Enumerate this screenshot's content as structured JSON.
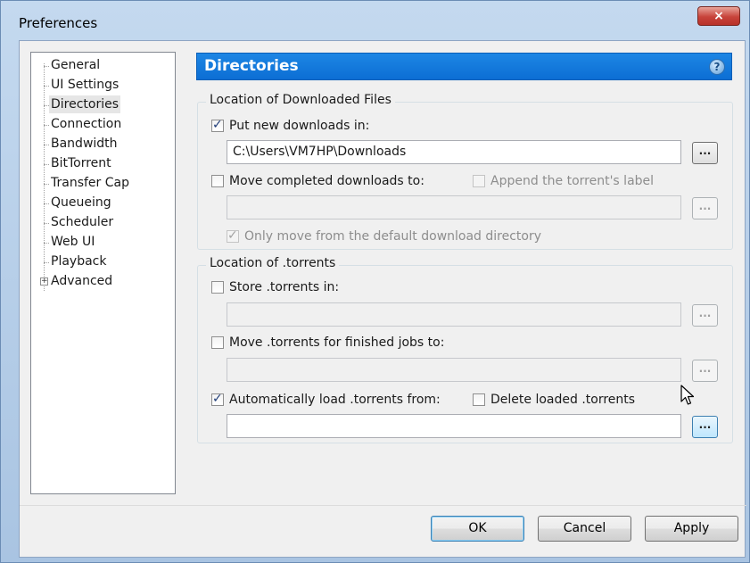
{
  "window": {
    "title": "Preferences",
    "close_label": "×"
  },
  "sidebar": {
    "items": [
      {
        "label": "General"
      },
      {
        "label": "UI Settings"
      },
      {
        "label": "Directories",
        "selected": true
      },
      {
        "label": "Connection"
      },
      {
        "label": "Bandwidth"
      },
      {
        "label": "BitTorrent"
      },
      {
        "label": "Transfer Cap"
      },
      {
        "label": "Queueing"
      },
      {
        "label": "Scheduler"
      },
      {
        "label": "Web UI"
      },
      {
        "label": "Playback"
      },
      {
        "label": "Advanced",
        "expandable": true,
        "expander": "+"
      }
    ]
  },
  "header": {
    "title": "Directories",
    "help_label": "?"
  },
  "downloaded_group": {
    "label": "Location of Downloaded Files",
    "put_new": {
      "label": "Put new downloads in:",
      "checked": true,
      "value": "C:\\Users\\VM7HP\\Downloads"
    },
    "move_completed": {
      "label": "Move completed downloads to:",
      "checked": false,
      "value": ""
    },
    "append_label": {
      "label": "Append the torrent's label",
      "checked": false,
      "disabled": true
    },
    "only_move": {
      "label": "Only move from the default download directory",
      "checked": true,
      "disabled": true
    }
  },
  "torrents_group": {
    "label": "Location of .torrents",
    "store": {
      "label": "Store .torrents in:",
      "checked": false,
      "value": ""
    },
    "move_finished": {
      "label": "Move .torrents for finished jobs to:",
      "checked": false,
      "value": ""
    },
    "auto_load": {
      "label": "Automatically load .torrents from:",
      "checked": true,
      "value": ""
    },
    "delete_loaded": {
      "label": "Delete loaded .torrents",
      "checked": false
    }
  },
  "browse_label": "...",
  "footer": {
    "ok_label": "OK",
    "cancel_label": "Cancel",
    "apply_label": "Apply"
  },
  "colors": {
    "header_blue": "#0c6ed4",
    "close_red": "#c7433a"
  }
}
